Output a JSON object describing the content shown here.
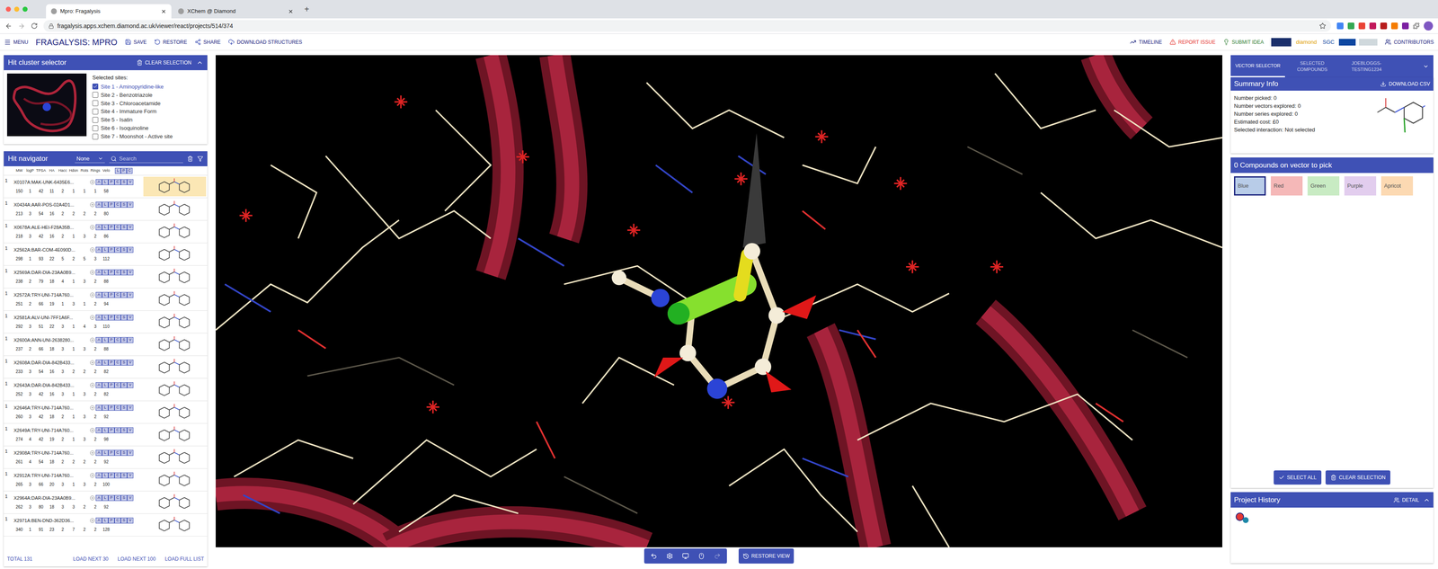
{
  "browser": {
    "tabs": [
      {
        "label": "Mpro: Fragalysis",
        "selected": true
      },
      {
        "label": "XChem @ Diamond",
        "selected": false
      }
    ],
    "new_tab": "+",
    "url": "fragalysis.apps.xchem.diamond.ac.uk/viewer/react/projects/514/374"
  },
  "header": {
    "menu": "MENU",
    "title": "FRAGALYSIS: MPRO",
    "actions": [
      "SAVE",
      "RESTORE",
      "SHARE",
      "DOWNLOAD STRUCTURES"
    ],
    "right_actions": [
      "TIMELINE",
      "REPORT ISSUE",
      "SUBMIT IDEA"
    ],
    "logos": [
      "diamond",
      "SGC"
    ],
    "contributors": "CONTRIBUTORS"
  },
  "hit_cluster_selector": {
    "title": "Hit cluster selector",
    "clear": "CLEAR SELECTION",
    "label": "Selected sites:",
    "sites": [
      {
        "label": "Site 1 - Aminopyridine-like",
        "checked": true
      },
      {
        "label": "Site 2 - Benzotriazole",
        "checked": false
      },
      {
        "label": "Site 3 - Chloroacetamide",
        "checked": false
      },
      {
        "label": "Site 4 - Immature Form",
        "checked": false
      },
      {
        "label": "Site 5 - Isatin",
        "checked": false
      },
      {
        "label": "Site 6 - Isoquinoline",
        "checked": false
      },
      {
        "label": "Site 7 - Moonshot - Active site",
        "checked": false
      }
    ]
  },
  "hit_navigator": {
    "title": "Hit navigator",
    "dropdown": "None",
    "search_placeholder": "Search",
    "columns": [
      "MW",
      "logP",
      "TPSA",
      "HA",
      "Hacc",
      "Hdon",
      "Rots",
      "Rings",
      "Velo"
    ],
    "toggle_columns": [
      "L",
      "P",
      "C"
    ],
    "controls": [
      "A",
      "L",
      "P",
      "C",
      "S",
      "V"
    ],
    "rows": [
      {
        "site": "1",
        "name": "X0107A:MAK-UNK-6435E6...",
        "values": [
          "150",
          "1",
          "42",
          "11",
          "2",
          "1",
          "1",
          "1",
          "58"
        ],
        "selected": true
      },
      {
        "site": "1",
        "name": "X0434A:AAR-POS-02A4D1...",
        "values": [
          "213",
          "3",
          "54",
          "16",
          "2",
          "2",
          "2",
          "2",
          "80"
        ],
        "selected": false
      },
      {
        "site": "1",
        "name": "X0678A:ALE-HEI-F28A35B...",
        "values": [
          "218",
          "3",
          "42",
          "16",
          "2",
          "1",
          "3",
          "2",
          "86"
        ],
        "selected": false
      },
      {
        "site": "1",
        "name": "X2562A:BAR-COM-4E090D...",
        "values": [
          "298",
          "1",
          "93",
          "22",
          "5",
          "2",
          "5",
          "3",
          "112"
        ],
        "selected": false
      },
      {
        "site": "1",
        "name": "X2569A:DAR-DIA-23AA0B9...",
        "values": [
          "238",
          "2",
          "79",
          "18",
          "4",
          "1",
          "3",
          "2",
          "88"
        ],
        "selected": false
      },
      {
        "site": "1",
        "name": "X2572A:TRY-UNI-714A760...",
        "values": [
          "251",
          "2",
          "66",
          "19",
          "1",
          "3",
          "1",
          "2",
          "94"
        ],
        "selected": false
      },
      {
        "site": "1",
        "name": "X2581A:ALV-UNI-7FF1A6F...",
        "values": [
          "292",
          "3",
          "51",
          "22",
          "3",
          "1",
          "4",
          "3",
          "110"
        ],
        "selected": false
      },
      {
        "site": "1",
        "name": "X2600A:ANN-UNI-2638280...",
        "values": [
          "237",
          "2",
          "66",
          "18",
          "3",
          "1",
          "3",
          "2",
          "88"
        ],
        "selected": false
      },
      {
        "site": "1",
        "name": "X2608A:DAR-DIA-842B433...",
        "values": [
          "233",
          "3",
          "54",
          "16",
          "3",
          "2",
          "2",
          "2",
          "82"
        ],
        "selected": false
      },
      {
        "site": "1",
        "name": "X2643A:DAR-DIA-842B433...",
        "values": [
          "252",
          "3",
          "42",
          "16",
          "3",
          "1",
          "3",
          "2",
          "82"
        ],
        "selected": false
      },
      {
        "site": "1",
        "name": "X2646A:TRY-UNI-714A760...",
        "values": [
          "260",
          "3",
          "42",
          "18",
          "2",
          "1",
          "3",
          "2",
          "92"
        ],
        "selected": false
      },
      {
        "site": "1",
        "name": "X2649A:TRY-UNI-714A760...",
        "values": [
          "274",
          "4",
          "42",
          "19",
          "2",
          "1",
          "3",
          "2",
          "98"
        ],
        "selected": false
      },
      {
        "site": "1",
        "name": "X2908A:TRY-UNI-714A760...",
        "values": [
          "261",
          "4",
          "54",
          "18",
          "2",
          "2",
          "2",
          "2",
          "92"
        ],
        "selected": false
      },
      {
        "site": "1",
        "name": "X2912A:TRY-UNI-714A760...",
        "values": [
          "265",
          "3",
          "66",
          "20",
          "3",
          "1",
          "3",
          "2",
          "100"
        ],
        "selected": false
      },
      {
        "site": "1",
        "name": "X2964A:DAR-DIA-23AA0B9...",
        "values": [
          "262",
          "3",
          "80",
          "18",
          "3",
          "3",
          "2",
          "2",
          "92"
        ],
        "selected": false
      },
      {
        "site": "1",
        "name": "X2971A:BEN-DND-362D36...",
        "values": [
          "340",
          "1",
          "91",
          "23",
          "2",
          "7",
          "2",
          "2",
          "128"
        ],
        "selected": false
      }
    ],
    "total": "TOTAL 131",
    "load": [
      "LOAD NEXT 30",
      "LOAD NEXT 100",
      "LOAD FULL LIST"
    ]
  },
  "viewer": {
    "toolbar": [
      {
        "kind": "undo",
        "disabled": false
      },
      {
        "kind": "settings",
        "disabled": false
      },
      {
        "kind": "display",
        "disabled": false
      },
      {
        "kind": "mouse",
        "disabled": false
      },
      {
        "kind": "redo",
        "disabled": true
      }
    ],
    "restore_view": "RESTORE VIEW"
  },
  "right_panel": {
    "tabs": [
      {
        "label": "VECTOR SELECTOR",
        "selected": true
      },
      {
        "label": "SELECTED COMPOUNDS",
        "selected": false
      },
      {
        "label": "JOEBLOGGS-TESTING1234",
        "selected": false
      }
    ],
    "summary": {
      "title": "Summary Info",
      "download": "DOWNLOAD CSV",
      "lines": [
        "Number picked: 0",
        "Number vectors explored: 0",
        "Number series explored: 0",
        "Estimated cost: £0",
        "Selected interaction: Not selected"
      ]
    },
    "compounds": {
      "title": "0 Compounds on vector to pick",
      "colors": [
        {
          "label": "Blue",
          "selected": true,
          "color": "#b8cce8"
        },
        {
          "label": "Red",
          "selected": false,
          "color": "#f5b8b8"
        },
        {
          "label": "Green",
          "selected": false,
          "color": "#c8ebc3"
        },
        {
          "label": "Purple",
          "selected": false,
          "color": "#e2cdee"
        },
        {
          "label": "Apricot",
          "selected": false,
          "color": "#fcd9b2"
        }
      ],
      "buttons": [
        "SELECT ALL",
        "CLEAR SELECTION"
      ]
    },
    "history": {
      "title": "Project History",
      "detail": "DETAIL"
    }
  }
}
